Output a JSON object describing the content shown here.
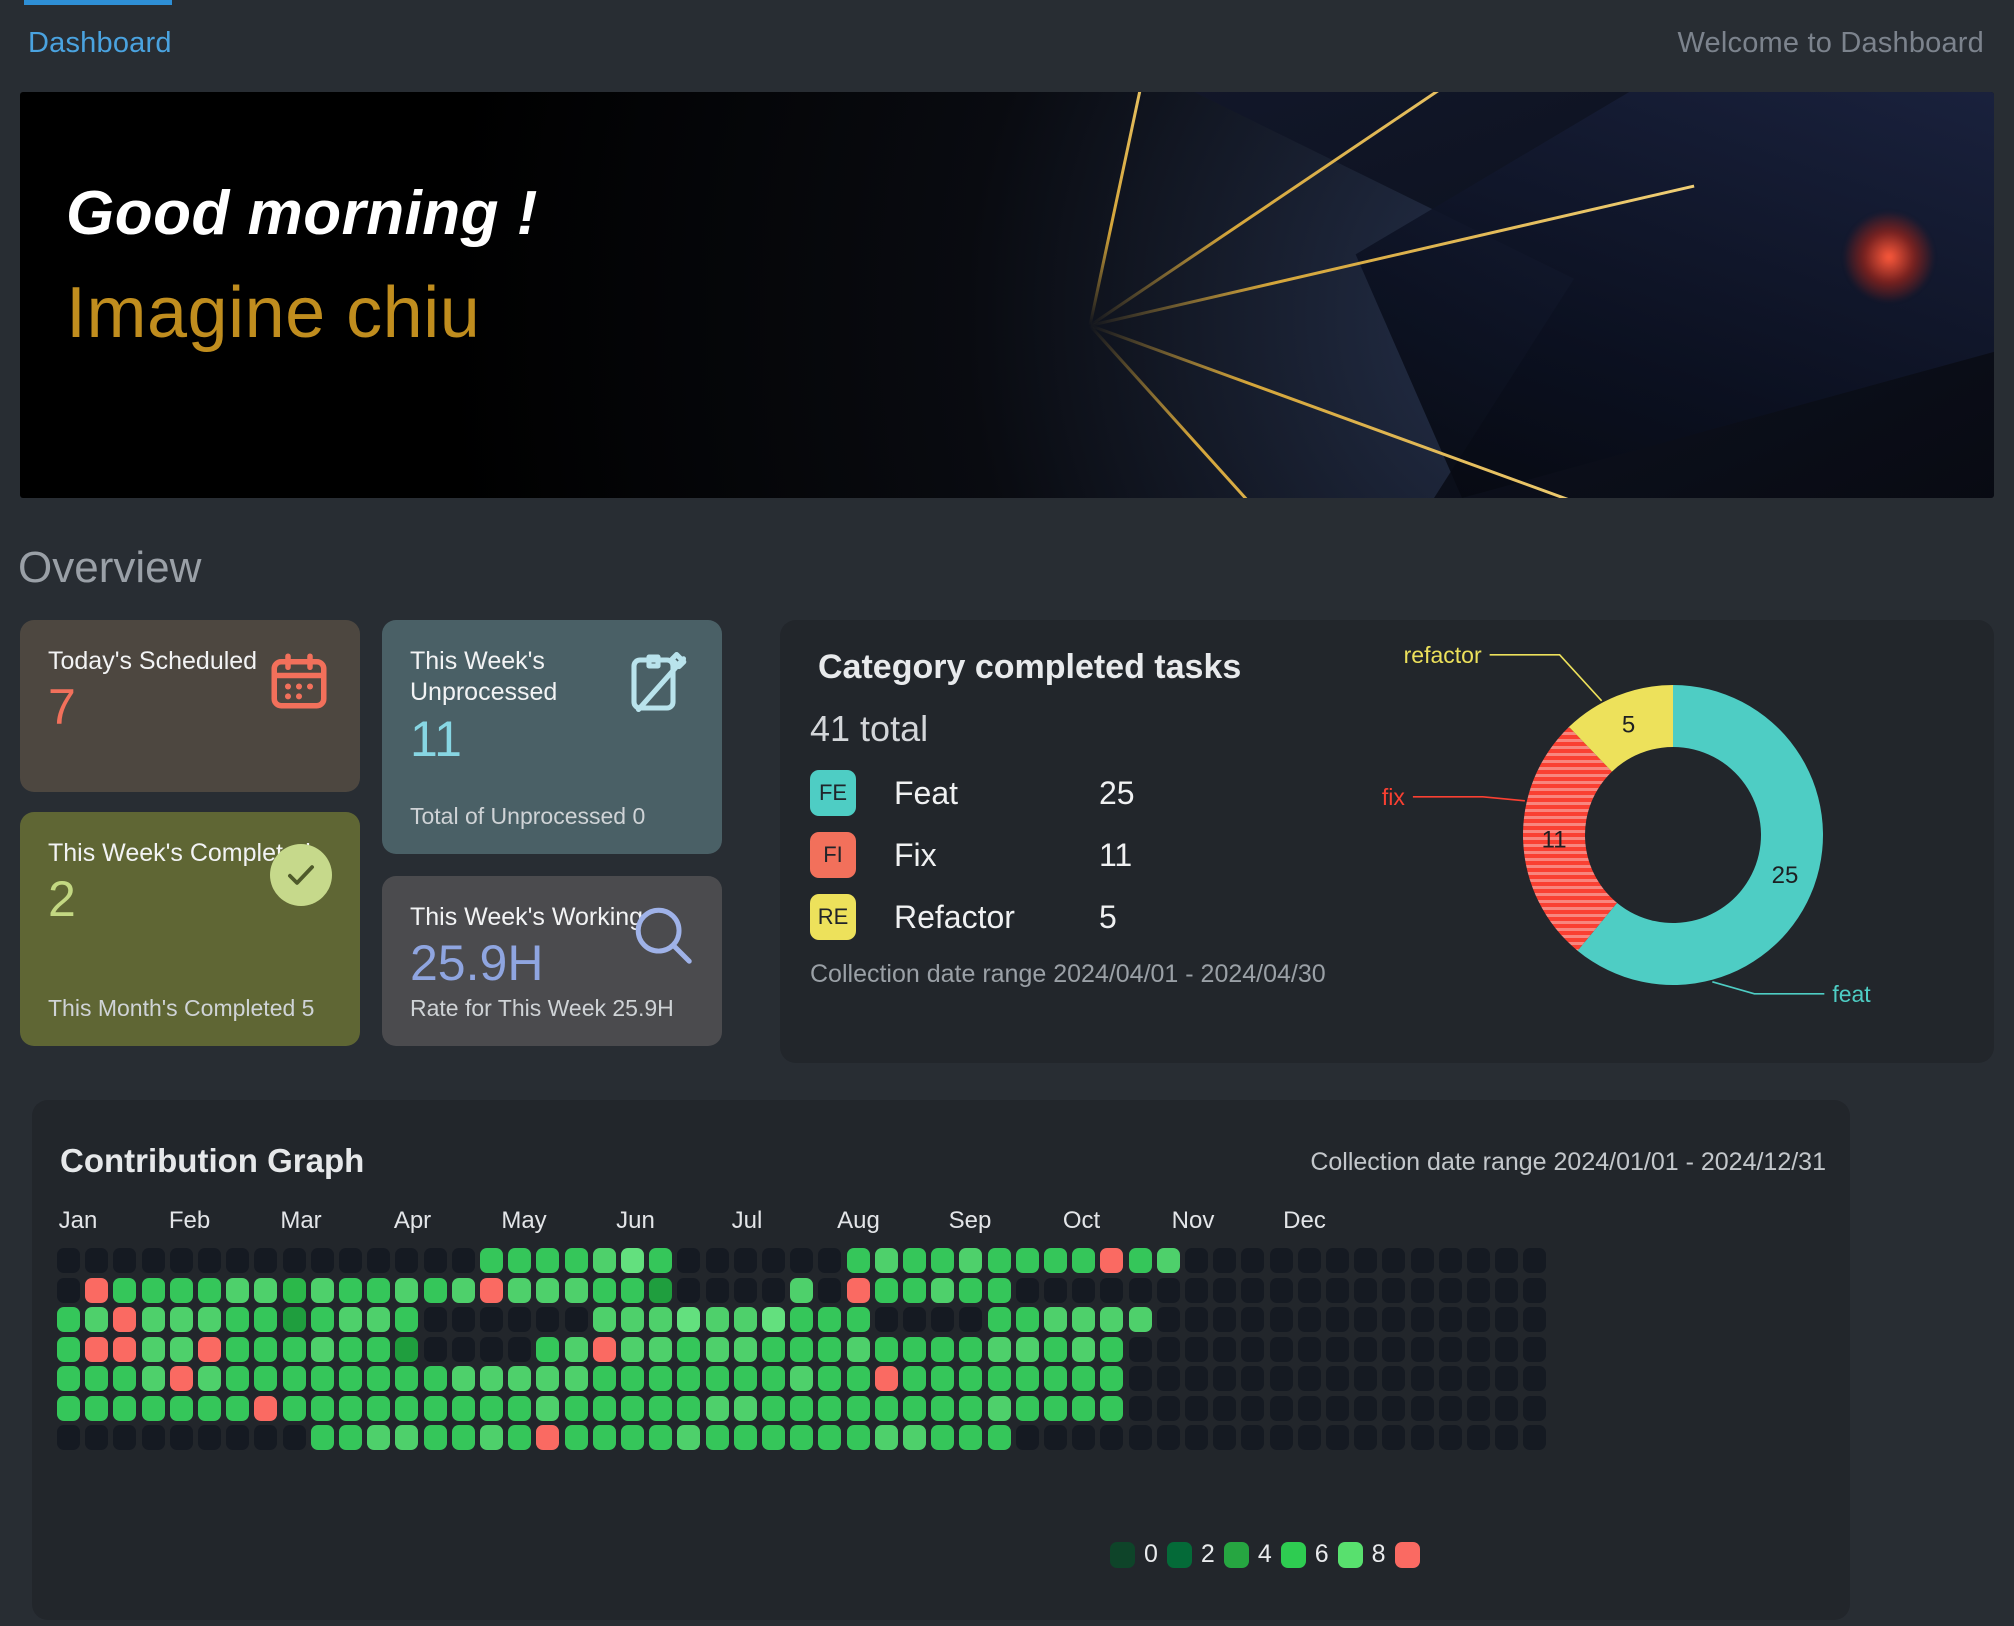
{
  "topbar": {
    "breadcrumb": "Dashboard",
    "welcome": "Welcome to Dashboard",
    "accent_color": "#2e8fd6"
  },
  "banner": {
    "greeting": "Good morning !",
    "username": "Imagine chiu",
    "username_color": "#c08d1e"
  },
  "overview": {
    "title": "Overview",
    "cards": [
      {
        "id": "scheduled",
        "label": "Today's Scheduled",
        "value": "7",
        "sub": "",
        "icon": "calendar-icon",
        "bg": "#4d4740",
        "value_color": "#f2705b"
      },
      {
        "id": "unprocessed",
        "label": "This Week's Unprocessed",
        "value": "11",
        "sub": "Total of Unprocessed 0",
        "icon": "clipboard-pencil-icon",
        "bg": "#4a6066",
        "value_color": "#87d6e3"
      },
      {
        "id": "completed",
        "label": "This Week's Completed",
        "value": "2",
        "sub": "This Month's Completed 5",
        "icon": "check-circle-icon",
        "bg": "#5f6634",
        "value_color": "#c3d882"
      },
      {
        "id": "working",
        "label": "This Week's Working",
        "value": "25.9H",
        "sub": "Rate for This Week 25.9H",
        "icon": "magnifier-icon",
        "bg": "#4b4b4e",
        "value_color": "#8fa5e0"
      }
    ]
  },
  "category": {
    "title": "Category completed tasks",
    "total_text": "41 total",
    "rows": [
      {
        "badge": "FE",
        "name": "Feat",
        "count": "25",
        "color": "#4ecdc4"
      },
      {
        "badge": "FI",
        "name": "Fix",
        "count": "11",
        "color": "#f2705b"
      },
      {
        "badge": "RE",
        "name": "Refactor",
        "count": "5",
        "color": "#ede15b"
      }
    ],
    "date_range": "Collection date range 2024/04/01 - 2024/04/30"
  },
  "chart_data": {
    "type": "pie",
    "title": "Category completed tasks",
    "subtitle": "41 total",
    "variant": "donut",
    "total": 41,
    "categories": [
      "feat",
      "fix",
      "refactor"
    ],
    "values": [
      25,
      11,
      5
    ],
    "colors": [
      "#4ecdc4",
      "#fa4032",
      "#ede15b"
    ],
    "patterns": [
      "solid",
      "horizontal-stripes",
      "solid"
    ],
    "slice_labels": [
      "25",
      "11",
      "5"
    ],
    "leader_labels": [
      "feat",
      "fix",
      "refactor"
    ],
    "legend_position": "left",
    "annotations": [
      "Collection date range 2024/04/01 - 2024/04/30"
    ]
  },
  "contribution": {
    "title": "Contribution Graph",
    "date_range": "Collection date range 2024/01/01 - 2024/12/31",
    "months": [
      "Jan",
      "Feb",
      "Mar",
      "Apr",
      "May",
      "Jun",
      "Jul",
      "Aug",
      "Sep",
      "Oct",
      "Nov",
      "Dec"
    ],
    "legend": {
      "numbers": [
        "0",
        "2",
        "4",
        "6",
        "8"
      ],
      "swatches": [
        "#0e4429",
        "#046a38",
        "#26a641",
        "#2ecc51",
        "#58e06e",
        "#fa6a62"
      ]
    },
    "colors": {
      "empty": "#151a22",
      "scale": [
        "#0e4429",
        "#046a38",
        "#1f9e3e",
        "#2bb84a",
        "#35c65a",
        "#4ed06b",
        "#63e07e"
      ],
      "red": "#fa6a62"
    },
    "weeks": 53,
    "rows": 7,
    "cells": [
      [
        0,
        0,
        0,
        0,
        0,
        0,
        0,
        0,
        0,
        0,
        0,
        0,
        0,
        0,
        0,
        4,
        4,
        4,
        4,
        5,
        6,
        4,
        0,
        0,
        0,
        0,
        0,
        0,
        4,
        5,
        4,
        4,
        5,
        4,
        4,
        4,
        4,
        9,
        4,
        5,
        0,
        0,
        0,
        0,
        0,
        0,
        0,
        0,
        0,
        0,
        0,
        0,
        0
      ],
      [
        0,
        9,
        4,
        4,
        4,
        4,
        5,
        5,
        3,
        5,
        4,
        4,
        5,
        4,
        5,
        9,
        5,
        5,
        5,
        4,
        4,
        2,
        0,
        0,
        0,
        0,
        5,
        0,
        9,
        4,
        4,
        5,
        4,
        4,
        0,
        0,
        0,
        0,
        0,
        0,
        0,
        0,
        0,
        0,
        0,
        0,
        0,
        0,
        0,
        0,
        0,
        0,
        0
      ],
      [
        4,
        5,
        9,
        5,
        5,
        5,
        4,
        4,
        2,
        4,
        5,
        5,
        4,
        0,
        0,
        0,
        0,
        0,
        0,
        5,
        5,
        5,
        6,
        5,
        5,
        6,
        4,
        4,
        4,
        0,
        0,
        0,
        0,
        4,
        4,
        5,
        5,
        5,
        5,
        0,
        0,
        0,
        0,
        0,
        0,
        0,
        0,
        0,
        0,
        0,
        0,
        0,
        0
      ],
      [
        4,
        9,
        9,
        5,
        5,
        9,
        4,
        4,
        4,
        5,
        4,
        4,
        2,
        0,
        0,
        0,
        0,
        4,
        5,
        9,
        5,
        5,
        4,
        5,
        5,
        4,
        4,
        4,
        5,
        4,
        4,
        4,
        4,
        5,
        5,
        4,
        5,
        4,
        0,
        0,
        0,
        0,
        0,
        0,
        0,
        0,
        0,
        0,
        0,
        0,
        0,
        0,
        0
      ],
      [
        4,
        4,
        4,
        5,
        9,
        5,
        4,
        4,
        4,
        4,
        4,
        4,
        4,
        4,
        5,
        5,
        5,
        5,
        5,
        4,
        4,
        4,
        4,
        4,
        4,
        4,
        5,
        4,
        4,
        9,
        4,
        4,
        4,
        4,
        4,
        4,
        4,
        4,
        0,
        0,
        0,
        0,
        0,
        0,
        0,
        0,
        0,
        0,
        0,
        0,
        0,
        0,
        0
      ],
      [
        4,
        4,
        4,
        4,
        4,
        4,
        4,
        9,
        4,
        4,
        4,
        4,
        4,
        4,
        4,
        4,
        4,
        5,
        4,
        4,
        4,
        4,
        4,
        5,
        5,
        4,
        4,
        4,
        4,
        4,
        4,
        4,
        4,
        5,
        4,
        4,
        4,
        4,
        0,
        0,
        0,
        0,
        0,
        0,
        0,
        0,
        0,
        0,
        0,
        0,
        0,
        0,
        0
      ],
      [
        0,
        0,
        0,
        0,
        0,
        0,
        0,
        0,
        0,
        4,
        4,
        5,
        5,
        4,
        4,
        5,
        4,
        9,
        4,
        4,
        4,
        4,
        5,
        4,
        4,
        4,
        4,
        4,
        4,
        5,
        5,
        4,
        4,
        4,
        0,
        0,
        0,
        0,
        0,
        0,
        0,
        0,
        0,
        0,
        0,
        0,
        0,
        0,
        0,
        0,
        0,
        0,
        0
      ]
    ]
  }
}
